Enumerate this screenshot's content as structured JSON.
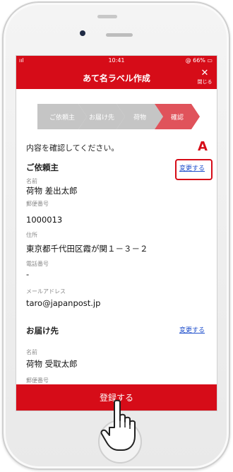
{
  "status": {
    "signal": "ııl",
    "time": "10:41",
    "battery": "@ 66% ▭"
  },
  "header": {
    "title": "あて名ラベル作成",
    "close_label": "閉じる"
  },
  "steps": [
    {
      "label": "ご依頼主"
    },
    {
      "label": "お届け先"
    },
    {
      "label": "荷物"
    },
    {
      "label": "確認"
    }
  ],
  "intro": "内容を確認してください。",
  "marker": "A",
  "sender": {
    "title": "ご依頼主",
    "change": "変更する",
    "fields": [
      {
        "label": "名前",
        "value": "荷物 差出太郎"
      },
      {
        "label": "郵便番号",
        "value": "1000013"
      },
      {
        "label": "住所",
        "value": "東京都千代田区霞が関１－３－２"
      },
      {
        "label": "電話番号",
        "value": "-"
      },
      {
        "label": "メールアドレス",
        "value": "taro@japanpost.jp"
      }
    ]
  },
  "recipient": {
    "title": "お届け先",
    "change": "変更する",
    "fields": [
      {
        "label": "名前",
        "value": "荷物 受取太郎"
      },
      {
        "label": "郵便番号",
        "value": ""
      }
    ]
  },
  "submit_label": "登録する",
  "colors": {
    "brand_red": "#d60c18",
    "step_active": "#e0535b",
    "step_inactive": "#c5c5c5",
    "link": "#1f4fcc"
  },
  "icons": [
    "close-icon",
    "pointing-hand-icon"
  ]
}
